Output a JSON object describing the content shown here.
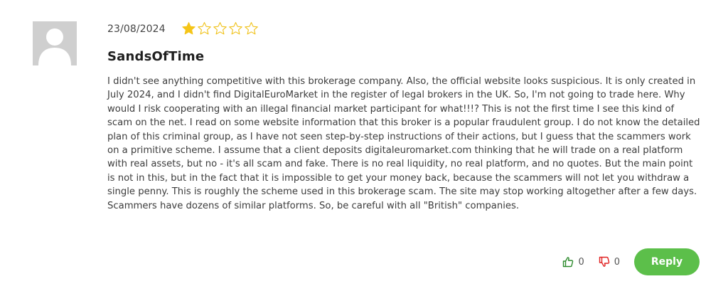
{
  "review": {
    "date": "23/08/2024",
    "rating": 1,
    "rating_max": 5,
    "author": "SandsOfTime",
    "text": "I didn't see anything competitive with this brokerage company. Also, the official website looks suspicious. It is only created in July 2024, and I didn't find DigitalEuroMarket in the register of legal brokers in the UK. So, I'm not going to trade here. Why would I risk cooperating with an illegal financial market participant for what!!!? This is not the first time I see this kind of scam on the net. I read on some website information that this broker is a popular fraudulent group. I do not know the detailed plan of this criminal group, as I have not seen step-by-step instructions of their actions, but I guess that the scammers work on a primitive scheme. I assume that a client deposits digitaleuromarket.com thinking that he will trade on a real platform with real assets, but no - it's all scam and fake. There is no real liquidity, no real platform, and no quotes. But the main point is not in this, but in the fact that it is impossible to get your money back, because the scammers will not let you withdraw a single penny. This is roughly the scheme used in this brokerage scam. The site may stop working altogether after a few days. Scammers have dozens of similar platforms. So, be careful with all \"British\" companies.",
    "likes": "0",
    "dislikes": "0",
    "reply_label": "Reply"
  },
  "colors": {
    "star_filled": "#f5c518",
    "star_empty_stroke": "#f0c21b",
    "like_icon": "#2e8b2e",
    "dislike_icon": "#e02020",
    "reply_bg": "#5cbf4a",
    "avatar_bg": "#cfcfcf"
  },
  "icons": {
    "avatar": "user-silhouette",
    "like": "thumbs-up-icon",
    "dislike": "thumbs-down-icon",
    "star": "star-icon"
  }
}
